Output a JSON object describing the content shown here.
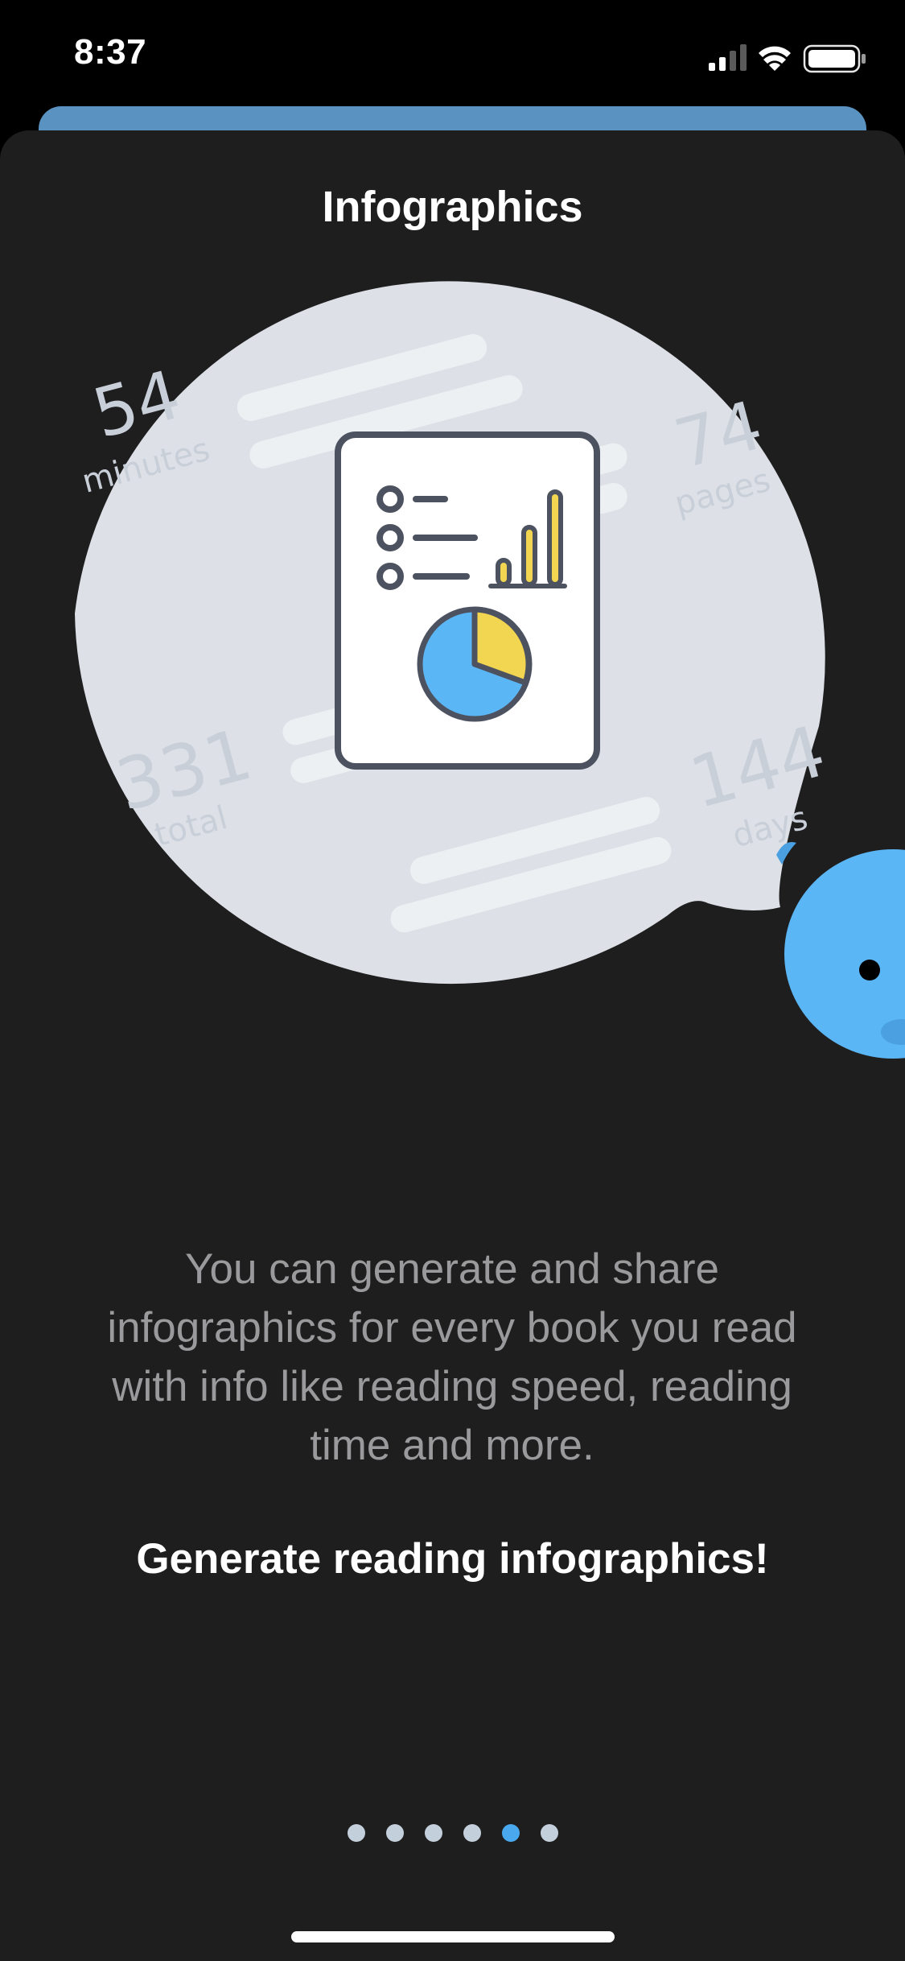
{
  "status_bar": {
    "time": "8:37"
  },
  "screen": {
    "title": "Infographics",
    "stats": {
      "minutes_value": "54",
      "minutes_label": "minutes",
      "pages_value": "74",
      "pages_label": "pages",
      "total_value": "331",
      "total_label": "total",
      "days_value": "144",
      "days_label": "days"
    },
    "description": "You can generate and share infographics for every book you read with info like reading speed, reading time and more.",
    "cta": "Generate reading infographics!"
  },
  "pager": {
    "count": 6,
    "active_index": 4
  },
  "colors": {
    "background": "#1e1e1f",
    "bubble": "#dde1e7",
    "accent_blue": "#5bb6f5",
    "accent_yellow": "#f2d551",
    "icon_stroke": "#4d5260"
  },
  "icons": {
    "document": "infographic-document-icon",
    "mascot": "blue-mascot"
  }
}
